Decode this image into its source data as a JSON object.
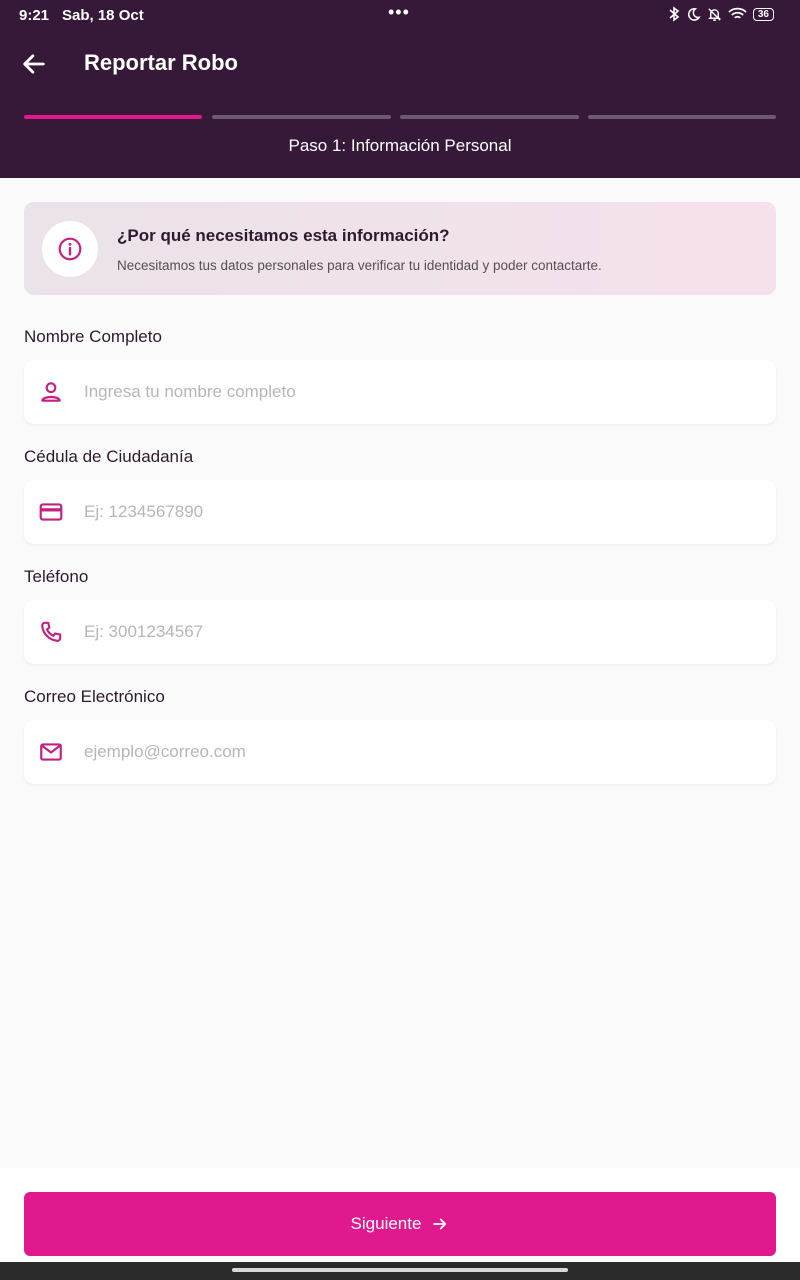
{
  "status_bar": {
    "time": "9:21",
    "date": "Sab, 18 Oct",
    "dots": "•••",
    "battery": "36",
    "icons": [
      "bluetooth-icon",
      "moon-icon",
      "bell-off-icon",
      "wifi-icon",
      "battery-icon"
    ]
  },
  "header": {
    "title": "Reportar Robo",
    "step_label": "Paso 1: Información Personal",
    "steps": [
      {
        "active": true
      },
      {
        "active": false
      },
      {
        "active": false
      },
      {
        "active": false
      }
    ]
  },
  "info_card": {
    "title": "¿Por qué necesitamos esta información?",
    "text": "Necesitamos tus datos personales para verificar tu identidad y poder contactarte.",
    "icon": "info-icon"
  },
  "form": {
    "fields": [
      {
        "label": "Nombre Completo",
        "value": "",
        "placeholder": "Ingresa tu nombre completo",
        "icon": "person-icon"
      },
      {
        "label": "Cédula de Ciudadanía",
        "value": "",
        "placeholder": "Ej: 1234567890",
        "icon": "credit-card-icon"
      },
      {
        "label": "Teléfono",
        "value": "",
        "placeholder": "Ej: 3001234567",
        "icon": "phone-icon"
      },
      {
        "label": "Correo Electrónico",
        "value": "",
        "placeholder": "ejemplo@correo.com",
        "icon": "mail-icon"
      }
    ]
  },
  "actions": {
    "next_label": "Siguiente",
    "next_icon": "arrow-right-icon"
  },
  "colors": {
    "header_bg": "#361939",
    "accent": "#e0198f",
    "step_inactive": "#6e5a70",
    "icon": "#c2217f",
    "background": "#fafafa"
  }
}
